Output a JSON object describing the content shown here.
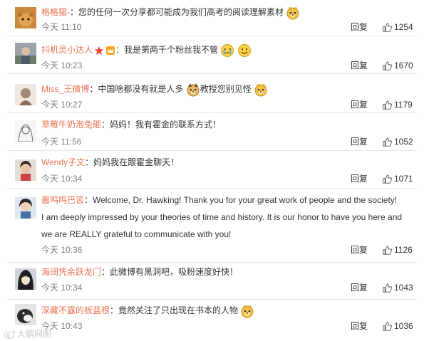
{
  "colors": {
    "username": "#eb7350",
    "text": "#333333",
    "meta": "#808080",
    "separator": "#e6e6e6"
  },
  "reply_label": "回复",
  "watermark": "大鹏网图",
  "comments": [
    {
      "username": "格格猫-",
      "text": "：您的任何一次分享都可能成为我们高考的阅读理解素材",
      "trailing_emoji": "doge-emoji",
      "time": "今天 11:10",
      "likes": "1254"
    },
    {
      "username": "抖机灵小达人",
      "badges": [
        "star-badge",
        "crown-badge"
      ],
      "text": "：我是第两千个粉丝我不管",
      "trailing_emoji": "crying-emoji, smile-emoji",
      "time": "今天 10:23",
      "likes": "1670"
    },
    {
      "username": "Miss_王微博",
      "text": "：中国啥都没有就是人多",
      "mid_emoji": "doge-emoji",
      "text_after": "教授您别见怪",
      "trailing_emoji": "doge-emoji",
      "time": "今天 10:27",
      "likes": "1179"
    },
    {
      "username": "草莓牛奶泡兔砸",
      "text": "：妈妈！我有霍金的联系方式！",
      "time": "今天 11:56",
      "likes": "1052"
    },
    {
      "username": "Wendy子文",
      "text": "：妈妈我在跟霍金聊天！",
      "time": "今天 10:34",
      "likes": "1071"
    },
    {
      "username": "酱鸣鸣巴苦",
      "text": "：Welcome, Dr. Hawking! Thank you for your great work of people and the society!",
      "extra_lines": [
        "I am deeply impressed by your theories of time and history. It is our honor to have you here and",
        "we are REALLY grateful to communicate with you!"
      ],
      "time": "今天 10:36",
      "likes": "1126"
    },
    {
      "username": "海阔凭余跃龙门",
      "text": "：此微博有黑洞吧，吸粉速度好快！",
      "time": "今天 10:34",
      "likes": "1043"
    },
    {
      "username": "深藏不露的板蓝根",
      "text": "：竟然关注了只出现在书本的人物",
      "trailing_emoji": "doge-emoji",
      "time": "今天 10:43",
      "likes": "1036"
    }
  ]
}
